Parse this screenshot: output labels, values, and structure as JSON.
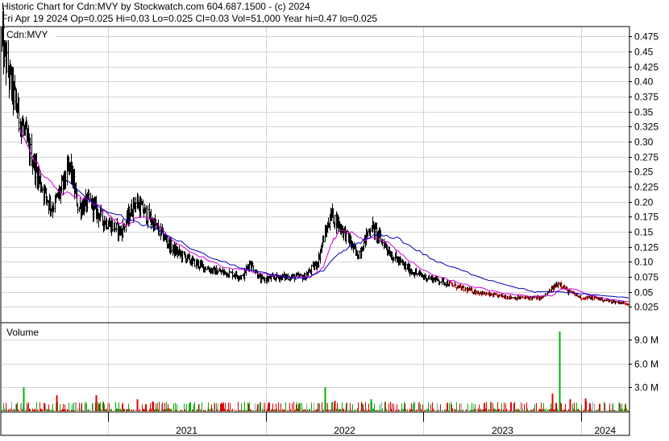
{
  "header": {
    "line1": "Historic Chart for Cdn:MVY by Stockwatch.com 604.687.1500 - (c) 2024",
    "line2": "Fri Apr 19 2024   Op=0.025   Hi=0.03   Lo=0.025   Cl=0.03   Vol=51,000   Year hi=0.47   lo=0.025"
  },
  "colors": {
    "price_bar": "#000000",
    "ma_short": "#d000d0",
    "ma_long": "#0000c0",
    "vol_up": "#00b000",
    "vol_down": "#e00000",
    "vol_neutral": "#a0a0a0",
    "grid": "#d4d4d4"
  },
  "chart_data": [
    {
      "type": "line",
      "panel": "price",
      "label": "Cdn:MVY",
      "ylim": [
        0.0,
        0.49
      ],
      "yticks": [
        "0.025",
        "0.05",
        "0.075",
        "0.10",
        "0.125",
        "0.15",
        "0.175",
        "0.20",
        "0.225",
        "0.25",
        "0.275",
        "0.30",
        "0.325",
        "0.35",
        "0.375",
        "0.40",
        "0.425",
        "0.45",
        "0.475"
      ],
      "x_range": [
        "2020-05-01",
        "2024-04-19"
      ],
      "years": [
        "2021",
        "2022",
        "2023",
        "2024"
      ],
      "year_starts": [
        "2021-01-01",
        "2022-01-01",
        "2023-01-01",
        "2024-01-01"
      ],
      "price_close_anchors": {
        "x": [
          "2020-05-01",
          "2020-05-20",
          "2020-06-15",
          "2020-07-15",
          "2020-08-10",
          "2020-08-25",
          "2020-09-15",
          "2020-10-05",
          "2020-10-25",
          "2020-11-20",
          "2020-12-20",
          "2021-02-01",
          "2021-03-05",
          "2021-03-30",
          "2021-05-01",
          "2021-06-01",
          "2021-07-15",
          "2021-09-01",
          "2021-10-15",
          "2021-11-08",
          "2021-11-25",
          "2021-12-20",
          "2022-02-01",
          "2022-04-01",
          "2022-05-01",
          "2022-05-15",
          "2022-06-01",
          "2022-06-20",
          "2022-07-01",
          "2022-08-01",
          "2022-09-01",
          "2022-10-01",
          "2022-10-20",
          "2022-12-01",
          "2023-01-01",
          "2023-02-01",
          "2023-04-01",
          "2023-06-01",
          "2023-08-01",
          "2023-10-01",
          "2023-11-01",
          "2023-11-10",
          "2023-12-01",
          "2024-01-01",
          "2024-02-01",
          "2024-03-01",
          "2024-04-19"
        ],
        "y": [
          0.47,
          0.4,
          0.33,
          0.26,
          0.21,
          0.19,
          0.22,
          0.26,
          0.19,
          0.2,
          0.17,
          0.15,
          0.2,
          0.18,
          0.15,
          0.12,
          0.1,
          0.085,
          0.08,
          0.075,
          0.1,
          0.07,
          0.075,
          0.075,
          0.1,
          0.14,
          0.18,
          0.16,
          0.15,
          0.11,
          0.16,
          0.13,
          0.11,
          0.085,
          0.075,
          0.07,
          0.055,
          0.045,
          0.04,
          0.04,
          0.06,
          0.065,
          0.05,
          0.04,
          0.04,
          0.035,
          0.03
        ]
      },
      "series": [
        {
          "role": "short moving average",
          "x": [
            "2020-06-10",
            "2020-07-15",
            "2020-08-15",
            "2020-09-15",
            "2020-10-15",
            "2020-11-15",
            "2020-12-15",
            "2021-01-15",
            "2021-02-15",
            "2021-03-15",
            "2021-04-15",
            "2021-06-01",
            "2021-08-01",
            "2021-10-01",
            "2021-11-20",
            "2022-01-01",
            "2022-03-01",
            "2022-04-15",
            "2022-05-15",
            "2022-06-01",
            "2022-06-20",
            "2022-07-15",
            "2022-08-15",
            "2022-09-15",
            "2022-10-15",
            "2022-11-15",
            "2023-01-01",
            "2023-03-01",
            "2023-05-01",
            "2023-07-01",
            "2023-09-01",
            "2023-10-25",
            "2023-11-15",
            "2023-12-15",
            "2024-01-15",
            "2024-03-01",
            "2024-04-19"
          ],
          "y": [
            0.325,
            0.27,
            0.235,
            0.215,
            0.21,
            0.205,
            0.19,
            0.17,
            0.16,
            0.175,
            0.17,
            0.135,
            0.11,
            0.09,
            0.085,
            0.08,
            0.075,
            0.075,
            0.09,
            0.13,
            0.15,
            0.15,
            0.135,
            0.14,
            0.13,
            0.11,
            0.085,
            0.07,
            0.058,
            0.048,
            0.043,
            0.043,
            0.055,
            0.055,
            0.045,
            0.038,
            0.034
          ]
        },
        {
          "role": "long moving average",
          "x": [
            "2020-10-01",
            "2020-12-01",
            "2021-02-01",
            "2021-04-01",
            "2021-06-01",
            "2021-08-01",
            "2021-10-01",
            "2021-12-01",
            "2022-02-01",
            "2022-04-01",
            "2022-05-15",
            "2022-06-15",
            "2022-07-15",
            "2022-08-15",
            "2022-09-15",
            "2022-11-01",
            "2022-12-15",
            "2023-02-01",
            "2023-04-01",
            "2023-06-01",
            "2023-08-01",
            "2023-09-15",
            "2023-11-01",
            "2023-12-15",
            "2024-02-01",
            "2024-04-19"
          ],
          "y": [
            0.235,
            0.195,
            0.175,
            0.16,
            0.14,
            0.115,
            0.098,
            0.085,
            0.076,
            0.072,
            0.085,
            0.11,
            0.125,
            0.135,
            0.145,
            0.14,
            0.12,
            0.1,
            0.085,
            0.07,
            0.058,
            0.05,
            0.05,
            0.048,
            0.045,
            0.04
          ]
        }
      ]
    },
    {
      "type": "bar",
      "panel": "volume",
      "title": "Volume",
      "ylim": [
        0,
        11.0
      ],
      "yticks": [
        "3.0 M",
        "6.0 M",
        "9.0 M"
      ],
      "spikes": [
        {
          "x": "2020-06-20",
          "value": 3.0
        },
        {
          "x": "2020-09-05",
          "value": 2.0
        },
        {
          "x": "2020-12-05",
          "value": 2.0
        },
        {
          "x": "2021-03-10",
          "value": 1.5
        },
        {
          "x": "2021-04-15",
          "value": 1.2
        },
        {
          "x": "2022-05-18",
          "value": 3.0
        },
        {
          "x": "2022-06-10",
          "value": 1.3
        },
        {
          "x": "2022-09-01",
          "value": 1.5
        },
        {
          "x": "2023-10-25",
          "value": 2.2
        },
        {
          "x": "2023-11-10",
          "value": 10.0
        },
        {
          "x": "2023-12-05",
          "value": 1.5
        },
        {
          "x": "2024-01-10",
          "value": 1.6
        }
      ]
    }
  ]
}
